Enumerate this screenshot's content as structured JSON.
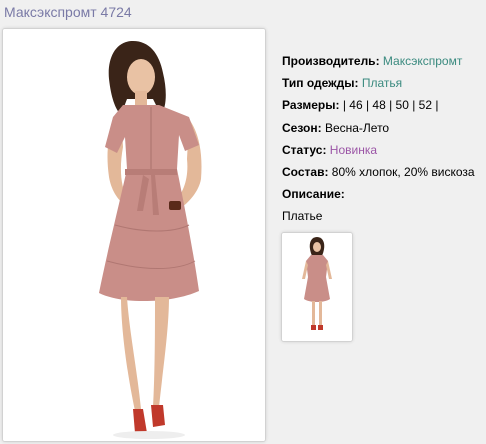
{
  "product": {
    "title": "Максэкспромт 4724"
  },
  "properties": {
    "manufacturer": {
      "label": "Производитель:",
      "value": "Максэкспромт"
    },
    "clothing_type": {
      "label": "Тип одежды:",
      "value": "Платья"
    },
    "sizes": {
      "label": "Размеры:",
      "value": "| 46 | 48 | 50 | 52 |"
    },
    "season": {
      "label": "Сезон:",
      "value": "Весна-Лето"
    },
    "status": {
      "label": "Статус:",
      "value": "Новинка"
    },
    "composition": {
      "label": "Состав:",
      "value": "80% хлопок, 20% вискоза"
    },
    "description": {
      "label": "Описание:",
      "value": "Платье"
    }
  },
  "colors": {
    "title": "#7a7aa6",
    "link_green": "#3a8a7f",
    "link_purple": "#9b55a6",
    "dress": "#c98e88"
  }
}
